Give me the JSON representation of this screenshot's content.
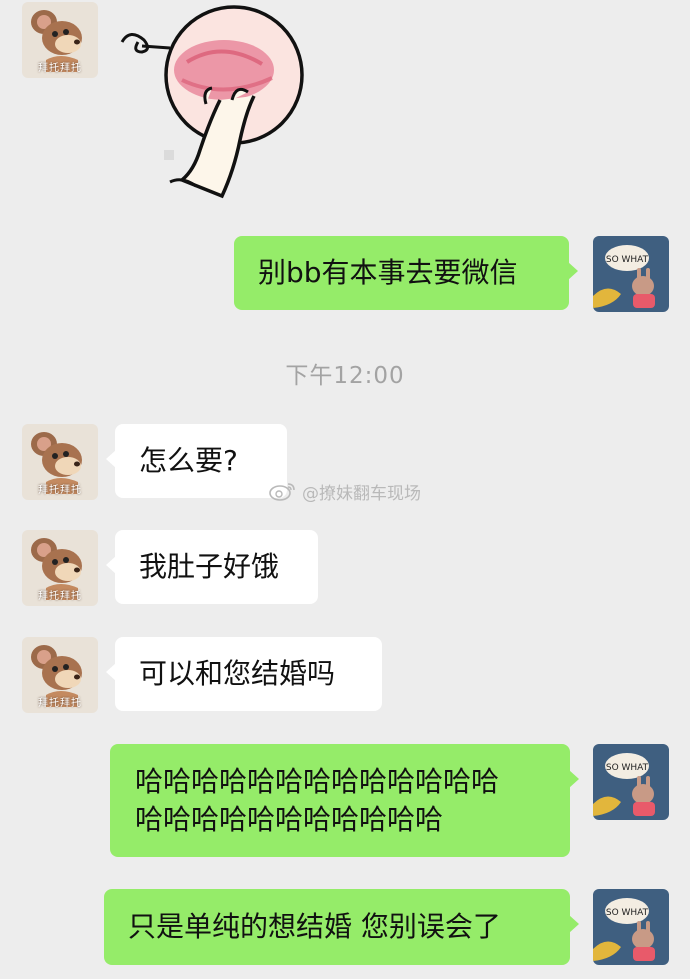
{
  "chat": {
    "timestamp": "下午12:00",
    "watermark": "@撩妹翻车现场",
    "avatar_left_caption": "拜托拜托",
    "avatar_right_caption": "SO WHAT",
    "messages": [
      {
        "side": "in",
        "kind": "sticker"
      },
      {
        "side": "out",
        "text": "别bb有本事去要微信"
      },
      {
        "side": "in",
        "text": "怎么要?"
      },
      {
        "side": "in",
        "text": "我肚子好饿"
      },
      {
        "side": "in",
        "text": "可以和您结婚吗"
      },
      {
        "side": "out",
        "lines": [
          "哈哈哈哈哈哈哈哈哈哈哈哈哈",
          "哈哈哈哈哈哈哈哈哈哈哈"
        ]
      },
      {
        "side": "out",
        "text": "只是单纯的想结婚 您别误会了"
      }
    ]
  },
  "colors": {
    "background": "#ededed",
    "bubble_in": "#ffffff",
    "bubble_out": "#95ec69",
    "timestamp": "#a3a3a3"
  }
}
